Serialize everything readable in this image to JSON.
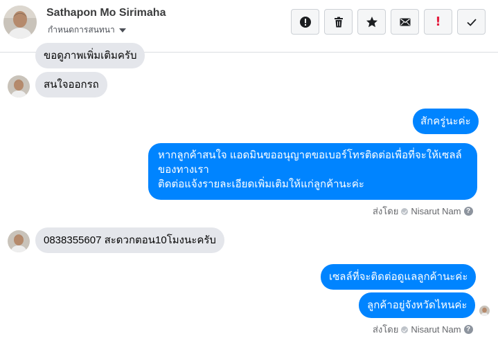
{
  "header": {
    "contact_name": "Sathapon Mo Sirimaha",
    "subtitle": "กำหนดการสนทนา",
    "toolbar_icons": [
      "alert-circle-icon",
      "trash-icon",
      "star-icon",
      "envelope-icon",
      "exclamation-icon",
      "check-icon"
    ],
    "exclamation_glyph": "!"
  },
  "messages": {
    "m1": "ขอดูภาพเพิ่มเติมครับ",
    "m2": "สนใจออกรถ",
    "m3": "สักครู่นะค่ะ",
    "m4_line1": "หากลูกค้าสนใจ แอดมินขออนุญาตขอเบอร์โทรติดต่อเพื่อที่จะให้เซลล์",
    "m4_line2": "ของทางเรา",
    "m4_line3": "ติดต่อแจ้งรายละเอียดเพิ่มเติมให้แก่ลูกค้านะค่ะ",
    "m5": "0838355607 สะดวกตอน10โมงนะครับ",
    "m6": "เซลล์ที่จะติดต่อดูแลลูกค้านะค่ะ",
    "m7": "ลูกค้าอยู่จังหวัดไหนค่ะ"
  },
  "sent_by": {
    "label": "ส่งโดย",
    "agent": "Nisarut Nam",
    "help_glyph": "?"
  },
  "colors": {
    "outgoing": "#0084ff",
    "incoming": "#e4e6eb",
    "alert_red": "#e41e3f"
  }
}
